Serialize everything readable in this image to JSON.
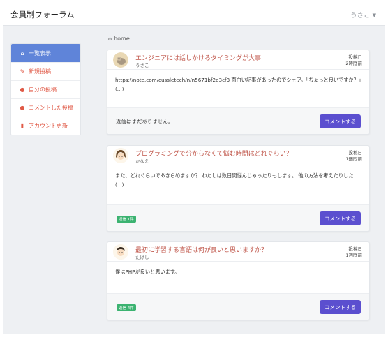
{
  "navbar": {
    "brand": "会員制フォーラム",
    "user": "うさこ"
  },
  "sidebar": {
    "items": [
      {
        "label": "一覧表示",
        "icon": "home-icon"
      },
      {
        "label": "新規投稿",
        "icon": "pencil-icon"
      },
      {
        "label": "自分の投稿",
        "icon": "user-edit-icon"
      },
      {
        "label": "コメントした投稿",
        "icon": "comments-icon"
      },
      {
        "label": "アカウント更新",
        "icon": "id-card-icon"
      }
    ]
  },
  "breadcrumb": {
    "label": "home"
  },
  "posts": [
    {
      "title": "エンジニアには話しかけるタイミングが大事",
      "author": "うさこ",
      "date_label": "投稿日",
      "date": "2時間前",
      "body": "https://note.com/cussletech/n/n5671bf2e3cf3 面白い記事があったのでシェア。「ちょっと良いですか？」(...)",
      "no_reply": "返信はまだありません。",
      "comment_label": "コメントする"
    },
    {
      "title": "プログラミングで分からなくて悩む時間はどれぐらい？",
      "author": "かなえ",
      "date_label": "投稿日",
      "date": "1週間前",
      "body": "また、どれぐらいであきらめますか？ わたしは数日間悩んじゃったりもします。 他の方法を考えたりした(...)",
      "badge": "返信 1件",
      "comment_label": "コメントする"
    },
    {
      "title": "最初に学習する言語は何が良いと思いますか？",
      "author": "たけし",
      "date_label": "投稿日",
      "date": "1週間前",
      "body": "僕はPHPが良いと思います。",
      "badge": "返信 4件",
      "comment_label": "コメントする"
    }
  ]
}
